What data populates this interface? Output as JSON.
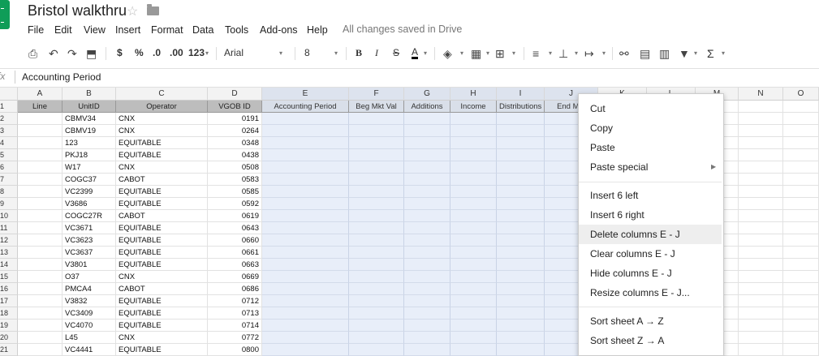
{
  "title": "Bristol walkthru",
  "menu": [
    "File",
    "Edit",
    "View",
    "Insert",
    "Format",
    "Data",
    "Tools",
    "Add-ons",
    "Help"
  ],
  "save_status": "All changes saved in Drive",
  "toolbar": {
    "currency": "$",
    "percent": "%",
    "dec_decrease": ".0",
    "dec_increase": ".00",
    "more_formats": "123",
    "font": "Arial",
    "font_size": "8",
    "bold": "B",
    "italic": "I",
    "strike": "S",
    "text_color": "A",
    "sum": "Σ"
  },
  "formula_bar": {
    "fx": "fx",
    "value": "Accounting Period"
  },
  "columns": [
    "A",
    "B",
    "C",
    "D",
    "E",
    "F",
    "G",
    "H",
    "I",
    "J",
    "K",
    "L",
    "M",
    "N",
    "O"
  ],
  "header_row": [
    "Line",
    "UnitID",
    "Operator",
    "VGOB ID",
    "Accounting Period",
    "Beg Mkt Val",
    "Additions",
    "Income",
    "Distributions",
    "End Mkt"
  ],
  "row_numbers": [
    "1",
    "2",
    "3",
    "4",
    "5",
    "6",
    "7",
    "8",
    "9",
    "10",
    "11",
    "12",
    "13",
    "14",
    "15",
    "16",
    "17",
    "18",
    "19",
    "20",
    "21"
  ],
  "rows": [
    {
      "unit": "CBMV34",
      "op": "CNX",
      "vgob": "0191"
    },
    {
      "unit": "CBMV19",
      "op": "CNX",
      "vgob": "0264"
    },
    {
      "unit": "123",
      "op": "EQUITABLE",
      "vgob": "0348"
    },
    {
      "unit": "PKJ18",
      "op": "EQUITABLE",
      "vgob": "0438"
    },
    {
      "unit": "W17",
      "op": "CNX",
      "vgob": "0508"
    },
    {
      "unit": "COGC37",
      "op": "CABOT",
      "vgob": "0583"
    },
    {
      "unit": "VC2399",
      "op": "EQUITABLE",
      "vgob": "0585"
    },
    {
      "unit": "V3686",
      "op": "EQUITABLE",
      "vgob": "0592"
    },
    {
      "unit": "COGC27R",
      "op": "CABOT",
      "vgob": "0619"
    },
    {
      "unit": "VC3671",
      "op": "EQUITABLE",
      "vgob": "0643"
    },
    {
      "unit": "VC3623",
      "op": "EQUITABLE",
      "vgob": "0660"
    },
    {
      "unit": "VC3637",
      "op": "EQUITABLE",
      "vgob": "0661"
    },
    {
      "unit": "V3801",
      "op": "EQUITABLE",
      "vgob": "0663"
    },
    {
      "unit": "O37",
      "op": "CNX",
      "vgob": "0669"
    },
    {
      "unit": "PMCA4",
      "op": "CABOT",
      "vgob": "0686"
    },
    {
      "unit": "V3832",
      "op": "EQUITABLE",
      "vgob": "0712"
    },
    {
      "unit": "VC3409",
      "op": "EQUITABLE",
      "vgob": "0713"
    },
    {
      "unit": "VC4070",
      "op": "EQUITABLE",
      "vgob": "0714"
    },
    {
      "unit": "L45",
      "op": "CNX",
      "vgob": "0772"
    },
    {
      "unit": "VC4441",
      "op": "EQUITABLE",
      "vgob": "0800"
    }
  ],
  "context_menu": {
    "items": [
      {
        "label": "Cut"
      },
      {
        "label": "Copy"
      },
      {
        "label": "Paste"
      },
      {
        "label": "Paste special"
      },
      {
        "label": "Insert 6 left"
      },
      {
        "label": "Insert 6 right"
      },
      {
        "label": "Delete columns E - J"
      },
      {
        "label": "Clear columns E - J"
      },
      {
        "label": "Hide columns E - J"
      },
      {
        "label": "Resize columns E - J..."
      },
      {
        "label": "Sort sheet A → Z"
      },
      {
        "label": "Sort sheet Z → A"
      }
    ],
    "highlighted": "Delete columns E - J"
  },
  "colors": {
    "selection": "#e8eef9",
    "selection_border": "#4d7fd6",
    "header_fill": "#bdbdbd",
    "logo": "#0f9d58"
  }
}
